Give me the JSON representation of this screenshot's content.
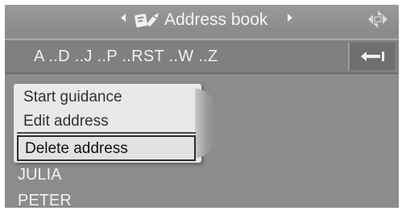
{
  "header": {
    "title": "Address book",
    "prev_icon": "arrow-left-icon",
    "next_icon": "arrow-right-icon",
    "book_icon": "address-book-icon",
    "settings_icon": "settings-icon"
  },
  "alphabet": {
    "ranges": "A ..D ..J ..P ..RST ..W ..Z",
    "backspace_icon": "backspace-arrow-icon"
  },
  "menu": {
    "items": [
      {
        "label": "Start guidance"
      },
      {
        "label": "Edit address"
      },
      {
        "label": "Delete address",
        "selected": true
      }
    ]
  },
  "contacts": [
    {
      "name": "JULIA"
    },
    {
      "name": "PETER"
    }
  ],
  "colors": {
    "background": "#8c8c8c",
    "text": "#f2f2f2",
    "menu_bg": "#e9e9e9"
  }
}
